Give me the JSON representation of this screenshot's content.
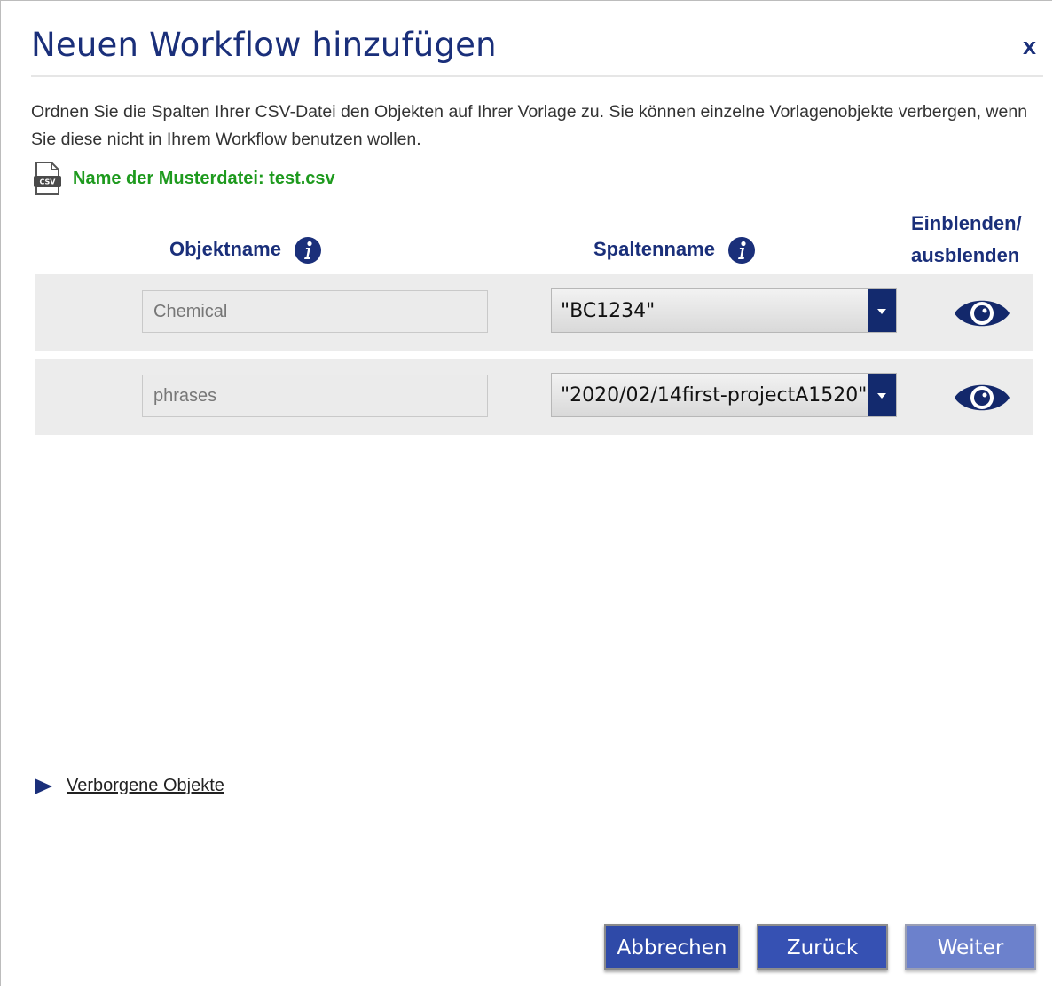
{
  "dialog": {
    "title": "Neuen Workflow hinzufügen",
    "close_label": "x",
    "intro": "Ordnen Sie die Spalten Ihrer CSV-Datei den Objekten auf Ihrer Vorlage zu. Sie können einzelne Vorlagenobjekte verbergen, wenn Sie diese nicht in Ihrem Workflow benutzen wollen.",
    "sample_file": {
      "icon": "csv-file-icon",
      "label": "Name der Musterdatei: test.csv"
    }
  },
  "columns": {
    "object_name": "Objektname",
    "column_name": "Spaltenname",
    "show_hide_line1": "Einblenden/",
    "show_hide_line2": "ausblenden",
    "info_icon": "info-icon"
  },
  "rows": [
    {
      "object": "Chemical",
      "column": "\"BC1234\"",
      "visibility_icon": "eye-icon"
    },
    {
      "object": "phrases",
      "column": "\"2020/02/14first-projectA1520\"",
      "visibility_icon": "eye-icon"
    }
  ],
  "hidden_objects": {
    "label": "Verborgene Objekte",
    "icon": "expand-triangle-icon"
  },
  "buttons": {
    "cancel": "Abbrechen",
    "back": "Zurück",
    "next": "Weiter"
  },
  "colors": {
    "primary": "#1a2f7a",
    "success": "#1e9a1e",
    "button": "#2f4aa8",
    "button_disabled": "#6c81cc"
  }
}
